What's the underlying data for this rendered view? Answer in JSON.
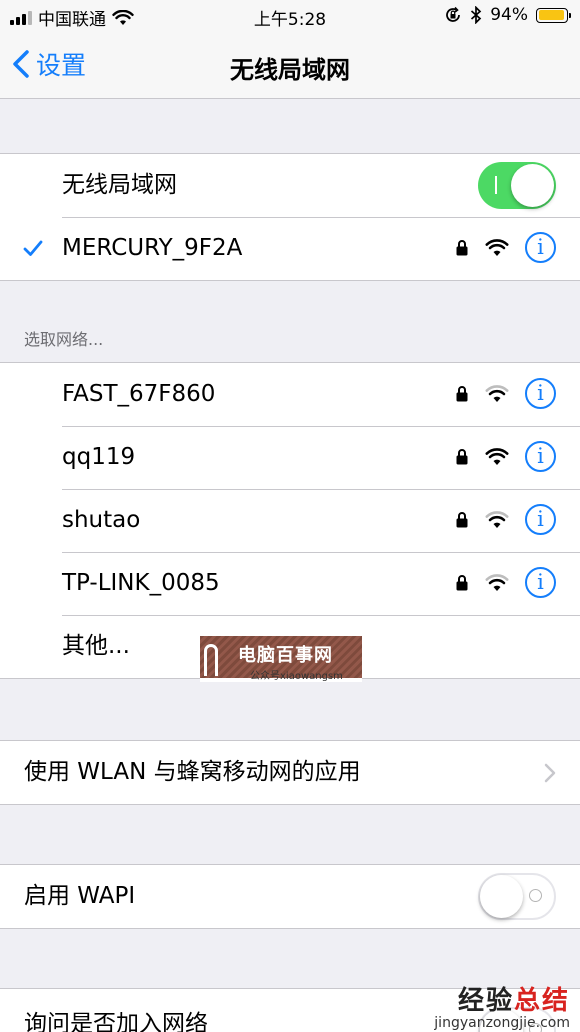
{
  "status_bar": {
    "carrier": "中国联通",
    "time": "上午5:28",
    "battery_percent": "94%",
    "battery_level": 0.94,
    "icons": [
      "cellular-signal-icon",
      "wifi-icon",
      "orientation-lock-icon",
      "bluetooth-icon",
      "battery-icon"
    ]
  },
  "nav": {
    "back_label": "设置",
    "title": "无线局域网"
  },
  "wlan": {
    "label": "无线局域网",
    "enabled": true
  },
  "connected": {
    "ssid": "MERCURY_9F2A",
    "icons": [
      "checkmark-icon",
      "lock-icon",
      "wifi-strength-icon",
      "info-icon"
    ]
  },
  "networks_header": "选取网络...",
  "networks": [
    {
      "ssid": "FAST_67F860",
      "secured": true,
      "bars": 2
    },
    {
      "ssid": "qq119",
      "secured": true,
      "bars": 3
    },
    {
      "ssid": "shutao",
      "secured": true,
      "bars": 2
    },
    {
      "ssid": "TP-LINK_0085",
      "secured": true,
      "bars": 2
    }
  ],
  "other_label": "其他...",
  "watermark": {
    "title": "电脑百事网",
    "subtitle": "公众号xiaowangsm"
  },
  "wlan_cellular_label": "使用 WLAN 与蜂窝移动网的应用",
  "wapi": {
    "label": "启用 WAPI",
    "enabled": false
  },
  "ask_join": {
    "label": "询问是否加入网络"
  },
  "footer_watermark": {
    "title_black": "经验",
    "title_red": "总结",
    "site": "jingyanzongjie.com"
  },
  "colors": {
    "accent": "#147efb",
    "toggle_on": "#4cd964",
    "background": "#efeff4",
    "battery": "#f9c413"
  }
}
